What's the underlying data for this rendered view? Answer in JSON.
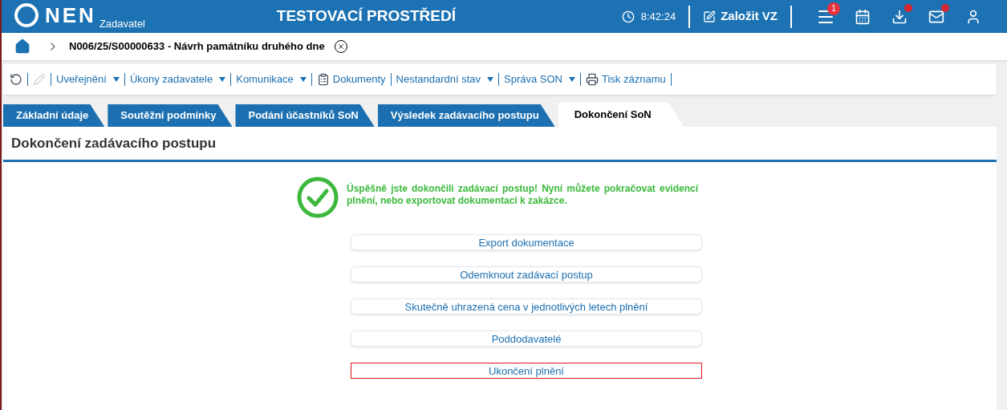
{
  "header": {
    "logo": "NEN",
    "subtitle": "Zadavatel",
    "environment": "TESTOVACÍ PROSTŘEDÍ",
    "time": "8:42:24",
    "create_button": "Založit VZ",
    "icons": [
      {
        "kind": "menu",
        "badge": "1"
      },
      {
        "kind": "calendar"
      },
      {
        "kind": "download",
        "dot": true
      },
      {
        "kind": "mail",
        "dot": true
      },
      {
        "kind": "user"
      }
    ]
  },
  "breadcrumb": {
    "title": "N006/25/S00000633 - Návrh památníku druhého dne"
  },
  "toolbar": [
    {
      "kind": "refresh",
      "disabled": false
    },
    {
      "kind": "edit",
      "disabled": true
    },
    {
      "kind": "menu",
      "label": "Uveřejnění"
    },
    {
      "kind": "menu",
      "label": "Úkony zadavatele"
    },
    {
      "kind": "menu",
      "label": "Komunikace"
    },
    {
      "kind": "documents",
      "label": "Dokumenty"
    },
    {
      "kind": "menu",
      "label": "Nestandardní stav"
    },
    {
      "kind": "menu",
      "label": "Správa SON"
    },
    {
      "kind": "print",
      "label": "Tisk záznamu"
    }
  ],
  "tabs": [
    {
      "label": "Základní údaje",
      "selected": false
    },
    {
      "label": "Soutěžní podmínky",
      "selected": false
    },
    {
      "label": "Podání účastníků SoN",
      "selected": false
    },
    {
      "label": "Výsledek zadávacího postupu",
      "selected": false
    },
    {
      "label": "Dokončení SoN",
      "selected": true
    }
  ],
  "section_title": "Dokončení zadávacího postupu",
  "success_message": "Úspěšně jste dokončili zadávací postup! Nyní můžete pokračovat evidencí plnění, nebo exportovat dokumentaci k zakázce.",
  "actions": [
    {
      "label": "Export dokumentace",
      "focused": false
    },
    {
      "label": "Odemknout zadávací postup",
      "focused": false
    },
    {
      "label": "Skutečně uhrazená cena v jednotlivých letech plnění",
      "focused": false
    },
    {
      "label": "Poddodavatelé",
      "focused": false
    },
    {
      "label": "Ukončení plnění",
      "focused": true
    }
  ]
}
